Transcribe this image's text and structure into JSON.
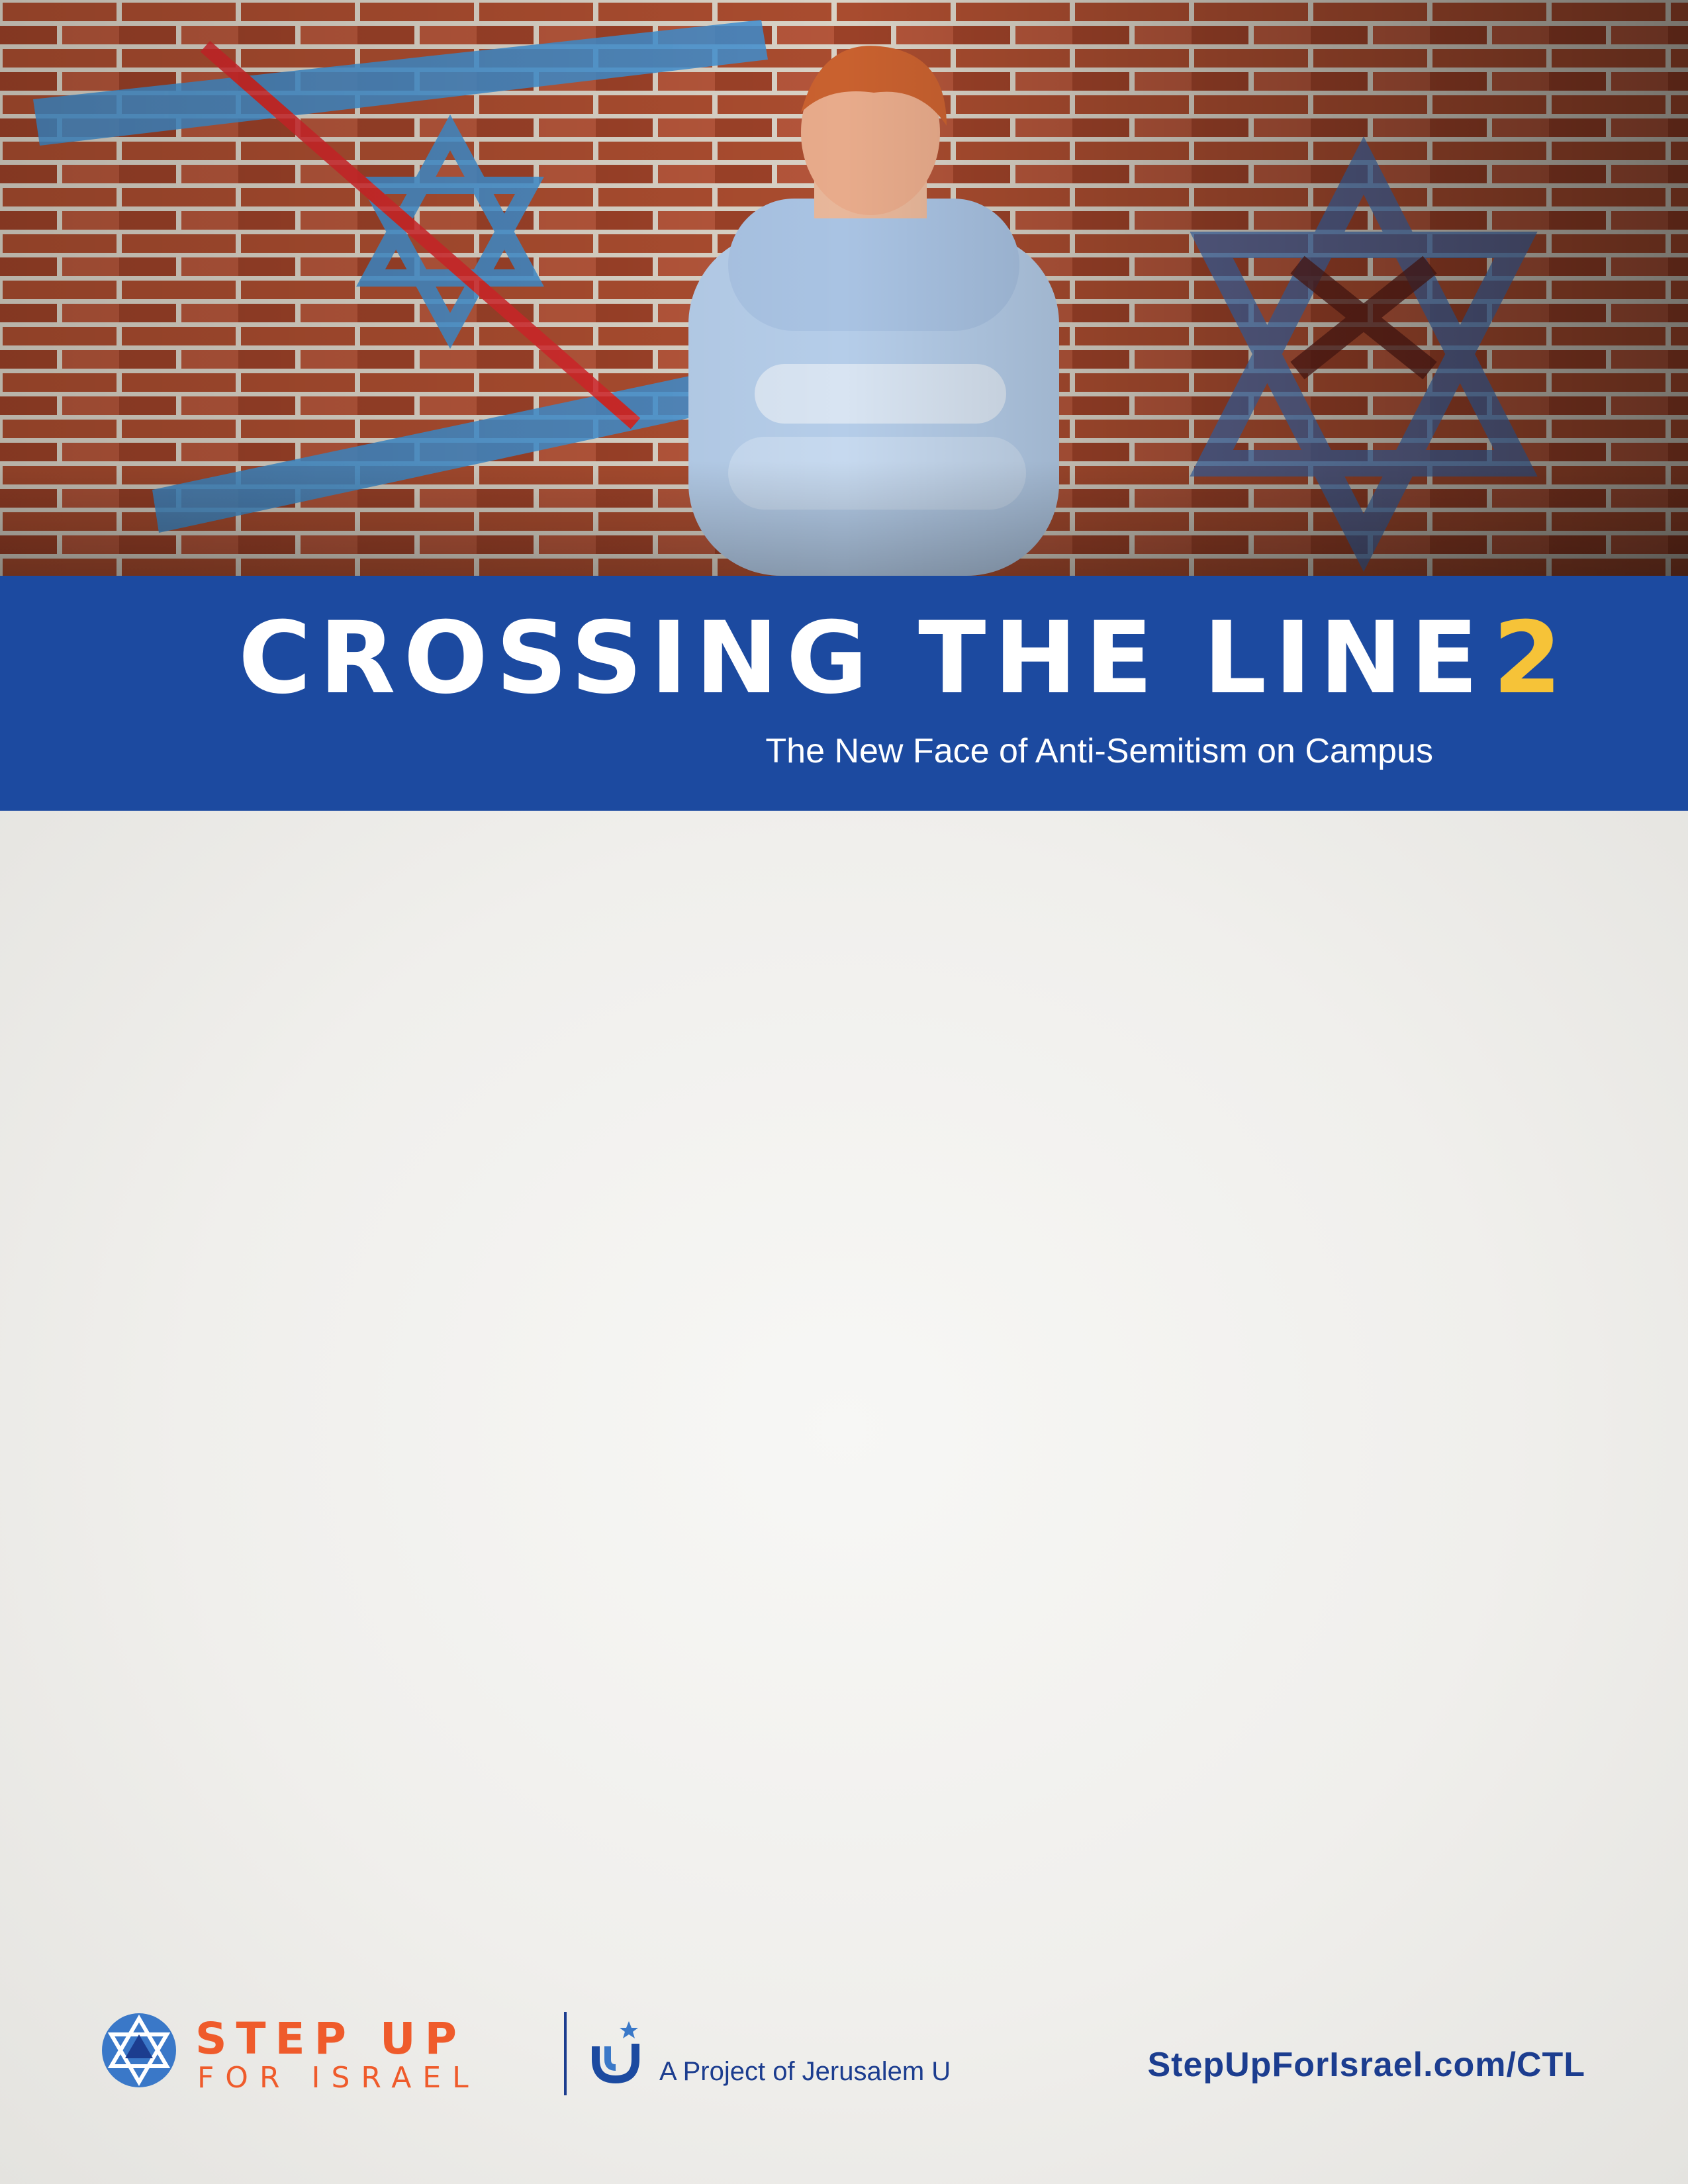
{
  "header": {
    "title_main": "CROSSING THE LINE",
    "title_number": "2",
    "subtitle": "The New Face of Anti-Semitism on Campus"
  },
  "footer": {
    "brand_line1": "STEP UP",
    "brand_line2": "FOR ISRAEL",
    "project_text": "A Project of Jerusalem U",
    "url": "StepUpForIsrael.com/CTL"
  },
  "colors": {
    "band_blue": "#1c4aa0",
    "title_accent_yellow": "#f6c338",
    "brand_orange": "#ef5b2b",
    "footer_navy": "#1c3d8f",
    "brick": "#a44a2c"
  },
  "icons": [
    "star-of-david-logo-icon",
    "jerusalem-u-logo-icon"
  ]
}
